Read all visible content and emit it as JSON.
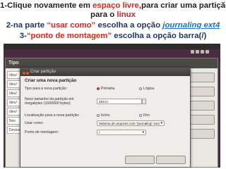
{
  "caption": {
    "line1_a": "1-Clique novamente em ",
    "line1_b": "espaço livre",
    "line1_c": ",para criar uma partição",
    "line2_a": "para o ",
    "line2_b": "linux",
    "line3_a": "2-na parte ",
    "line3_b": "“usar como”",
    "line3_c": " escolha a opção  ",
    "line3_d": "journaling ext4",
    "line4_a": "3-",
    "line4_b": "“ponto de montagem”",
    "line4_c": " escolha a opção barra(/)"
  },
  "dialog": {
    "title": "Criar partição",
    "heading": "Criar uma nova partição",
    "type_label": "Tipo para a nova partição:",
    "type_primary": "Primária",
    "type_logical": "Lógica",
    "size_label": "Novo tamanho da partição em megabytes (1000000 bytes):",
    "size_value": "48414",
    "location_label": "Localização para a nova partição:",
    "location_start": "Início",
    "location_end": "Fim",
    "use_as_label": "Usar como:",
    "use_as_value": "Sistema de arquivos com \"journaling\" ext4",
    "mount_label": "Ponto de montagem:",
    "mount_value": "/"
  },
  "background_window": {
    "title": "Tipo",
    "rows": [
      "/dev/",
      "/dev/",
      "/dev/",
      "/dev/",
      "/dev/"
    ],
    "left_labels": [
      "Nov",
      "Device"
    ]
  }
}
